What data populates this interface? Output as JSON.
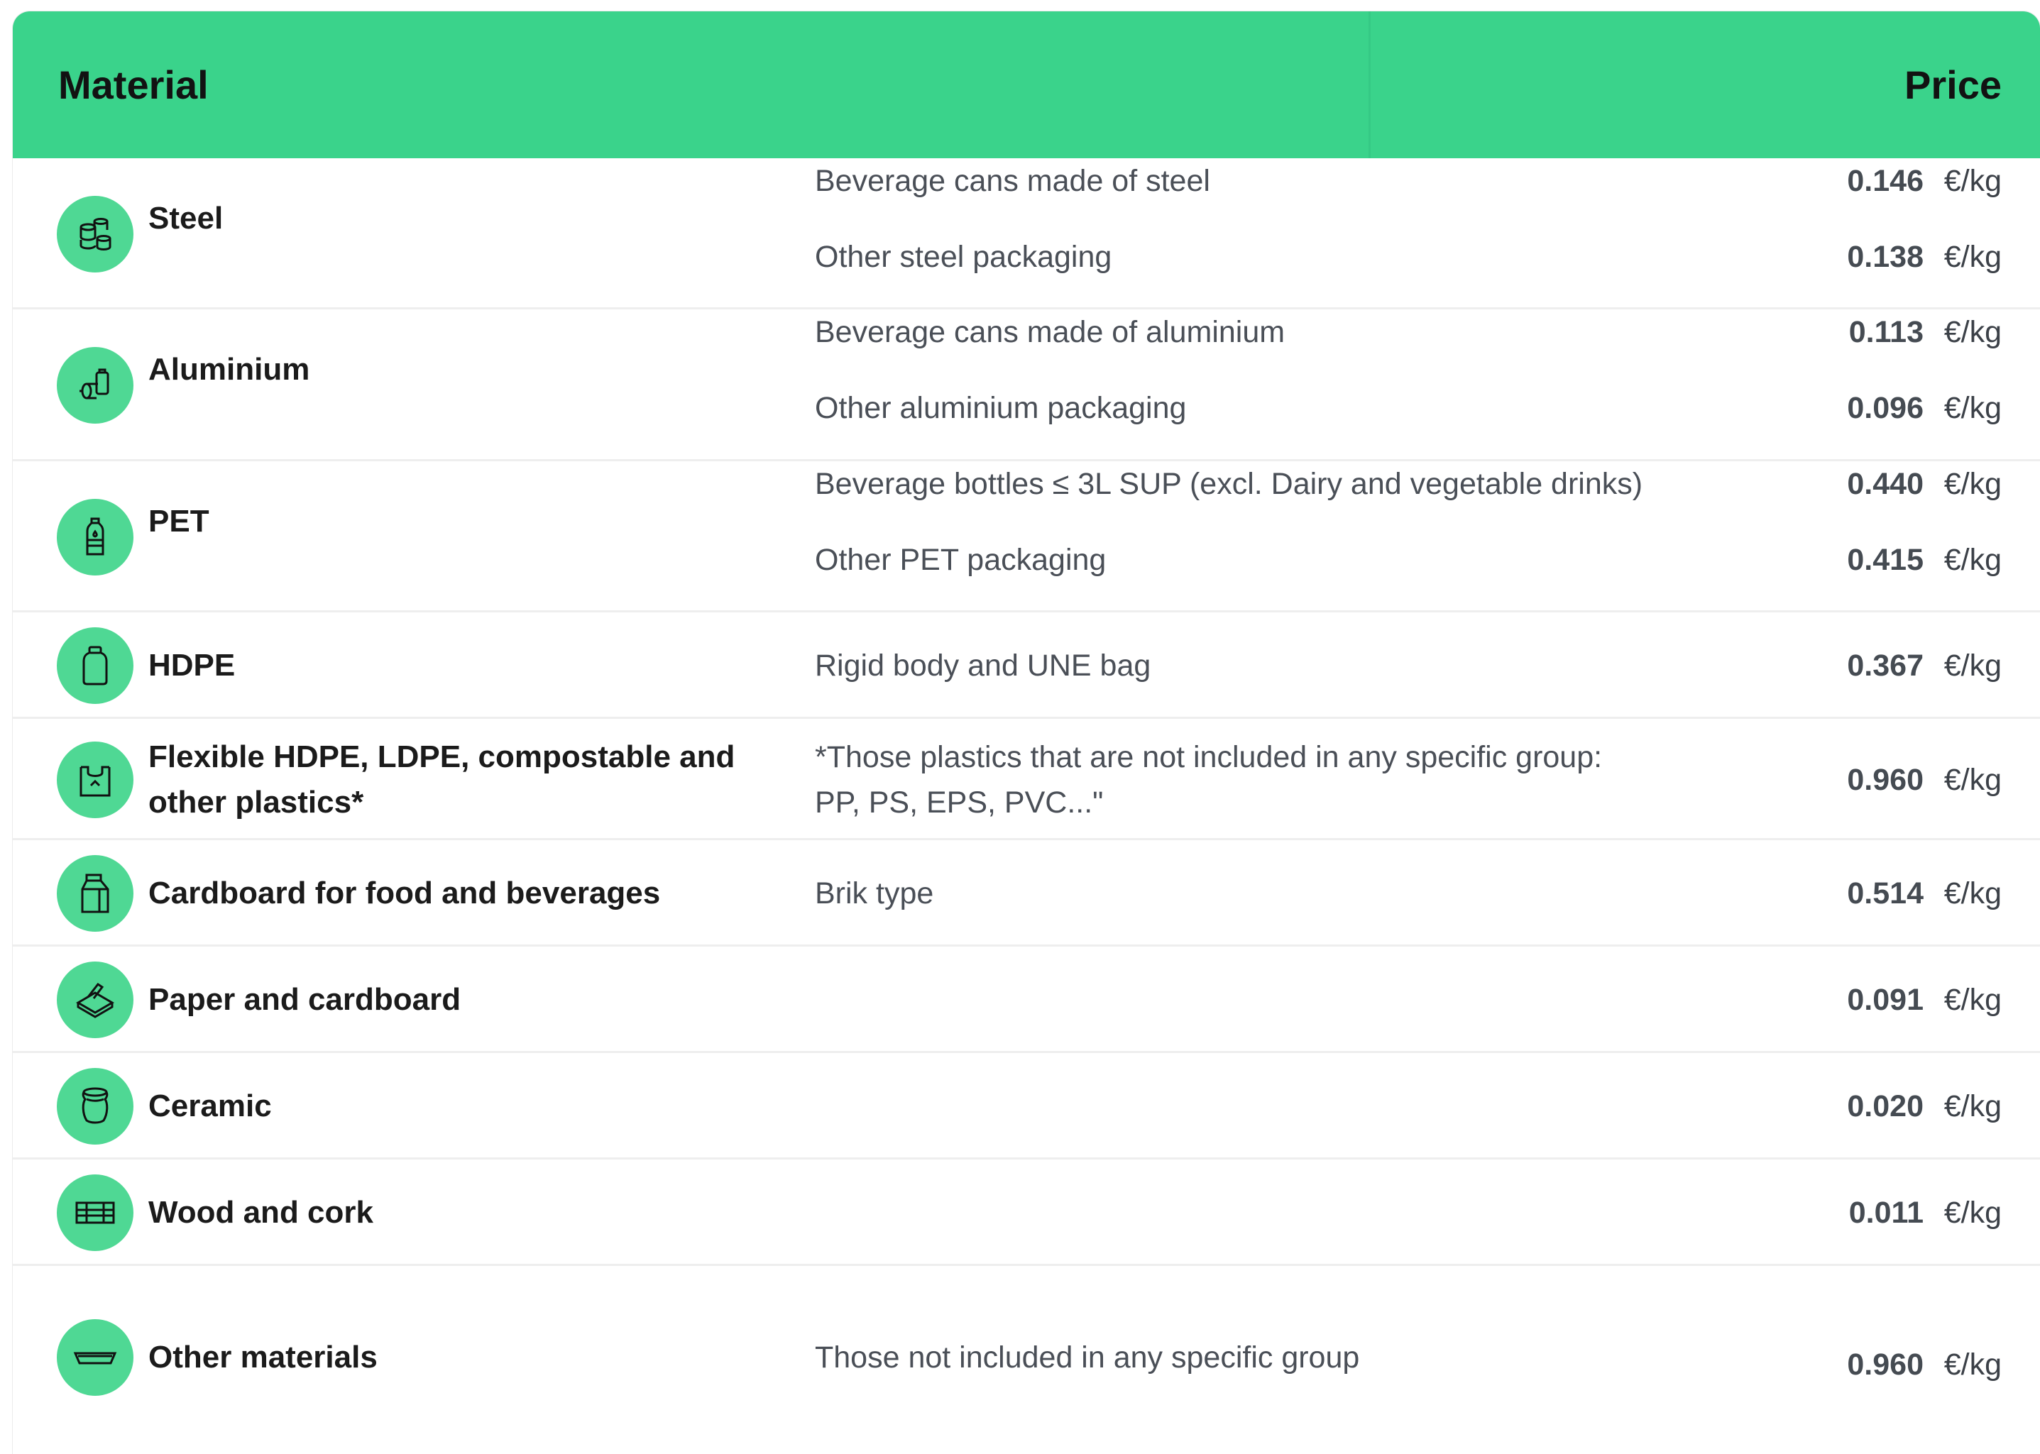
{
  "header": {
    "material_label": "Material",
    "price_label": "Price"
  },
  "colors": {
    "header_bg": "#3ad38b",
    "icon_bg": "#4fd894"
  },
  "rows": [
    {
      "material": "Steel",
      "icon": "steel-cans-icon",
      "lines": [
        {
          "desc": "Beverage cans made of steel",
          "price": "0.146",
          "unit": "€/kg"
        },
        {
          "desc": "Other steel packaging",
          "price": "0.138",
          "unit": "€/kg"
        }
      ]
    },
    {
      "material": "Aluminium",
      "icon": "aluminium-can-icon",
      "lines": [
        {
          "desc": "Beverage cans made of aluminium",
          "price": "0.113",
          "unit": "€/kg"
        },
        {
          "desc": "Other aluminium packaging",
          "price": "0.096",
          "unit": "€/kg"
        }
      ]
    },
    {
      "material": "PET",
      "icon": "pet-bottle-icon",
      "lines": [
        {
          "desc": "Beverage bottles ≤ 3L SUP (excl. Dairy and vegetable drinks)",
          "price": "0.440",
          "unit": "€/kg"
        },
        {
          "desc": "Other PET packaging",
          "price": "0.415",
          "unit": "€/kg"
        }
      ]
    },
    {
      "material": "HDPE",
      "icon": "hdpe-jar-icon",
      "lines": [
        {
          "desc": "Rigid body and UNE bag",
          "price": "0.367",
          "unit": "€/kg"
        }
      ]
    },
    {
      "material": " Flexible HDPE, LDPE, compostable and",
      "material_line2": "other plastics*",
      "icon": "plastic-bag-icon",
      "lines": [
        {
          "desc": "*Those plastics that are not included in any specific group:",
          "desc_line2": "PP, PS, EPS, PVC...\"",
          "price": "0.960",
          "unit": "€/kg"
        }
      ]
    },
    {
      "material": "Cardboard for food and beverages",
      "icon": "carton-icon",
      "lines": [
        {
          "desc": "Brik type",
          "price": "0.514",
          "unit": "€/kg"
        }
      ]
    },
    {
      "material": "Paper and cardboard",
      "icon": "cardboard-box-icon",
      "lines": [
        {
          "desc": "",
          "price": "0.091",
          "unit": "€/kg"
        }
      ]
    },
    {
      "material": "Ceramic",
      "icon": "ceramic-pot-icon",
      "lines": [
        {
          "desc": "",
          "price": "0.020",
          "unit": "€/kg"
        }
      ]
    },
    {
      "material": "Wood and cork",
      "icon": "wood-pallet-icon",
      "lines": [
        {
          "desc": "",
          "price": "0.011",
          "unit": "€/kg"
        }
      ]
    },
    {
      "material": "Other materials",
      "icon": "tray-icon",
      "lines": [
        {
          "desc": "Those not included in any specific group",
          "price": "0.960",
          "unit": "€/kg"
        }
      ]
    }
  ]
}
